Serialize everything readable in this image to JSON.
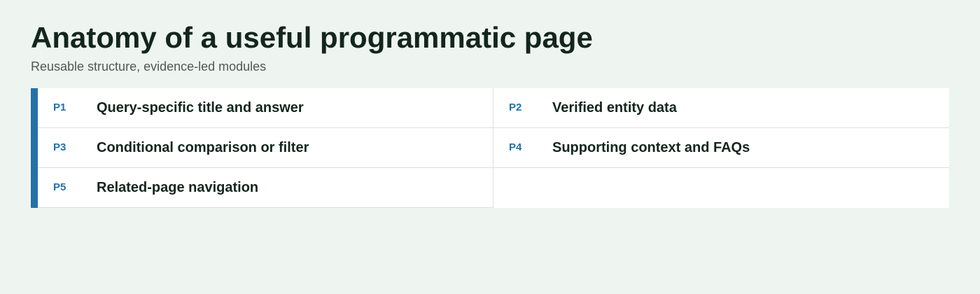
{
  "title": "Anatomy of a useful programmatic page",
  "subtitle": "Reusable structure, evidence-led modules",
  "colors": {
    "accent": "#2471a8",
    "code_text": "#2471a8"
  },
  "modules": [
    {
      "code": "P1",
      "label": "Query-specific title and answer"
    },
    {
      "code": "P2",
      "label": "Verified entity data"
    },
    {
      "code": "P3",
      "label": "Conditional comparison or filter"
    },
    {
      "code": "P4",
      "label": "Supporting context and FAQs"
    },
    {
      "code": "P5",
      "label": "Related-page navigation"
    }
  ]
}
